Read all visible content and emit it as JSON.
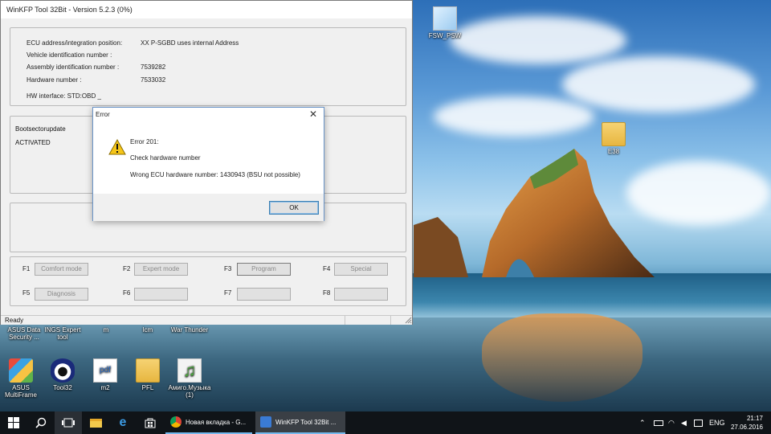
{
  "app_window": {
    "title": "WinKFP Tool 32Bit - Version 5.2.3 (0%)",
    "info": {
      "ecu_label": "ECU address/integration position:",
      "ecu_value": "XX    P-SGBD uses internal Address",
      "vin_label": "Vehicle identification number :",
      "assembly_label": "Assembly identification number :",
      "assembly_value": "7539282",
      "hardware_label": "Hardware number :",
      "hardware_value": "7533032",
      "hw_interface": "HW interface:  STD:OBD _"
    },
    "boot": {
      "title": "Bootsectorupdate",
      "state": "ACTIVATED"
    },
    "function_keys": [
      {
        "key": "F1",
        "label": "Comfort mode"
      },
      {
        "key": "F2",
        "label": "Expert mode"
      },
      {
        "key": "F3",
        "label": "Program"
      },
      {
        "key": "F4",
        "label": "Special"
      },
      {
        "key": "F5",
        "label": "Diagnosis"
      },
      {
        "key": "F6",
        "label": ""
      },
      {
        "key": "F7",
        "label": ""
      },
      {
        "key": "F8",
        "label": ""
      }
    ],
    "status": "Ready"
  },
  "error_dialog": {
    "title": "Error",
    "close_glyph": "✕",
    "line1": "Error 201:",
    "line2": "Check hardware number",
    "line3": "Wrong ECU hardware number: 1430943 (BSU not possible)",
    "ok_label": "OK"
  },
  "desktop_icons": [
    {
      "label": "FSW_PSW",
      "icon": "document-stack-icon"
    },
    {
      "label": "E38",
      "icon": "folder-icon"
    },
    {
      "label": "ASUS Data Security ...",
      "icon": "partial-icon"
    },
    {
      "label": "INGS Expert tool",
      "icon": "partial-icon"
    },
    {
      "label": "m",
      "icon": "partial-icon"
    },
    {
      "label": "lcm",
      "icon": "partial-icon"
    },
    {
      "label": "War Thunder",
      "icon": "partial-icon"
    },
    {
      "label": "ASUS MultiFrame",
      "icon": "shield-icon"
    },
    {
      "label": "Tool32",
      "icon": "eye-icon"
    },
    {
      "label": "m2",
      "icon": "pdf-icon"
    },
    {
      "label": "PFL",
      "icon": "folder-icon"
    },
    {
      "label": "Амиго.Музыка (1)",
      "icon": "music-icon"
    }
  ],
  "taskbar": {
    "apps": [
      {
        "label": "Новая вкладка - G...",
        "icon": "chrome-icon"
      },
      {
        "label": "WinKFP Tool 32Bit ...",
        "icon": "winkfp-icon"
      }
    ],
    "language": "ENG",
    "time": "21:17",
    "date": "27.06.2016"
  },
  "colors": {
    "taskbar_bg": "#101418",
    "accent": "#76b9ed",
    "dialog_border": "#6a94c8"
  }
}
